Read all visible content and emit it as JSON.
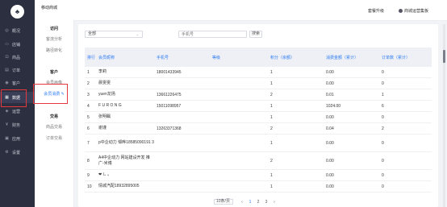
{
  "sidebar": {
    "logo": "♣",
    "items": [
      {
        "icon": "home-icon",
        "glyph": "◎",
        "label": "概况"
      },
      {
        "icon": "shop-icon",
        "glyph": "▭",
        "label": "店铺"
      },
      {
        "icon": "goods-icon",
        "glyph": "⊡",
        "label": "商品"
      },
      {
        "icon": "order-icon",
        "glyph": "▤",
        "label": "订单"
      },
      {
        "icon": "customer-icon",
        "glyph": "◉",
        "label": "客户"
      },
      {
        "icon": "data-icon",
        "glyph": "▦",
        "label": "数据"
      },
      {
        "icon": "marketing-icon",
        "glyph": "◈",
        "label": "运营"
      },
      {
        "icon": "finance-icon",
        "glyph": "¥",
        "label": "财务"
      },
      {
        "icon": "app-icon",
        "glyph": "▣",
        "label": "应用"
      },
      {
        "icon": "settings-icon",
        "glyph": "⚙",
        "label": "设置"
      }
    ]
  },
  "subnav": {
    "brand": "移动商城",
    "groups": [
      {
        "title": "访问",
        "items": [
          "客流分析",
          "路径转化"
        ]
      },
      {
        "title": "客户",
        "items": [
          "会员画像",
          "会员消费"
        ]
      },
      {
        "title": "交易",
        "items": [
          "商品交易",
          "订单交易"
        ]
      }
    ]
  },
  "header": {
    "upgrade": "套餐升级",
    "user": "商城运营集板"
  },
  "toolbar": {
    "filter_value": "全部",
    "search_placeholder": "手机号",
    "search_button": "搜索"
  },
  "table": {
    "columns": [
      "排行",
      "会员昵称",
      "手机号",
      "等级",
      "积分（余额）",
      "消费金额（累计）",
      "订单数（累计）"
    ],
    "rows": [
      [
        "1",
        "李莉",
        "18001433945",
        "",
        "1",
        "0.00",
        "0"
      ],
      [
        "2",
        "晨雯雯",
        "",
        "",
        "1",
        "0.00",
        "0"
      ],
      [
        "3",
        "yuen龙扬",
        "13661226475",
        "",
        "2",
        "0.01",
        "1"
      ],
      [
        "4",
        "F U R O N G",
        "15011098957",
        "",
        "1",
        "1024.00",
        "6"
      ],
      [
        "5",
        "张明瞩",
        "",
        "",
        "1",
        "0.00",
        "0"
      ],
      [
        "6",
        "谢谨",
        "13263371368",
        "",
        "2",
        "0.04",
        "2"
      ],
      [
        "7",
        "p中企动力 邹晔18585090191 3",
        "",
        "",
        "1",
        "0.00",
        "0"
      ],
      [
        "8",
        "A4中企动力 网站建设开发 推广-米博",
        "",
        "",
        "2",
        "0.00",
        "0"
      ],
      [
        "9",
        "❤ l₊ ₄",
        "",
        "",
        "1",
        "0.00",
        "0"
      ],
      [
        "10",
        "情城汽配18932895005",
        "",
        "",
        "1",
        "0.00",
        "0"
      ]
    ]
  },
  "pagination": {
    "page_size": "10条/页",
    "prev": "‹",
    "pages": [
      "1",
      "2",
      "3"
    ],
    "next": "›"
  }
}
